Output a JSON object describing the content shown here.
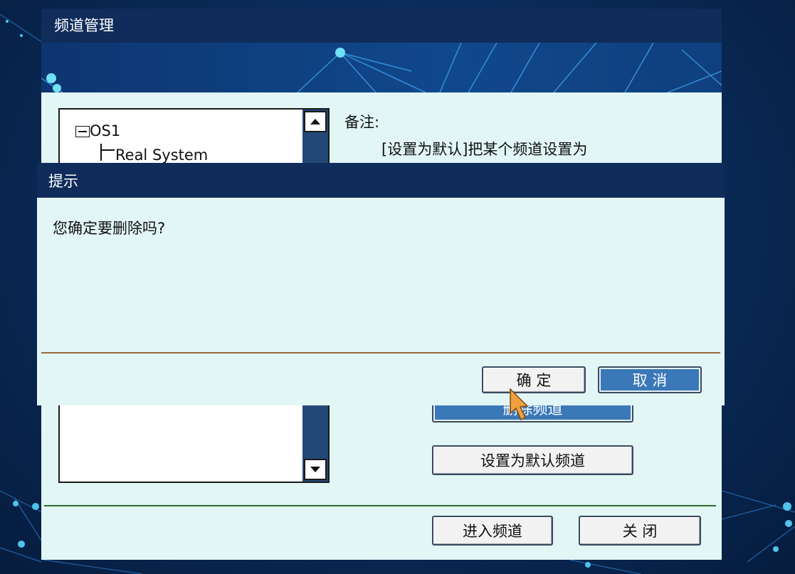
{
  "main_window": {
    "title": "频道管理",
    "tree": {
      "root": "OS1",
      "child": "Real System"
    },
    "note_label": "备注:",
    "note_text": "[设置为默认]把某个频道设置为",
    "buttons": {
      "delete_channel": "删除频道",
      "set_default_channel": "设置为默认频道",
      "enter_channel": "进入频道",
      "close": "关 闭"
    }
  },
  "dialog": {
    "title": "提示",
    "message": "您确定要删除吗?",
    "buttons": {
      "ok": "确 定",
      "cancel": "取 消"
    }
  },
  "colors": {
    "titlebar": "#0f2c5a",
    "panel": "#e2f6f6",
    "primary_button": "#3a78b8",
    "scrollbar": "#234877",
    "background": "#0a2d5c"
  },
  "icons": {
    "scroll_up": "triangle-up-icon",
    "scroll_down": "triangle-down-icon",
    "tree_collapse": "minus-box-icon",
    "cursor": "arrow-cursor-icon"
  }
}
